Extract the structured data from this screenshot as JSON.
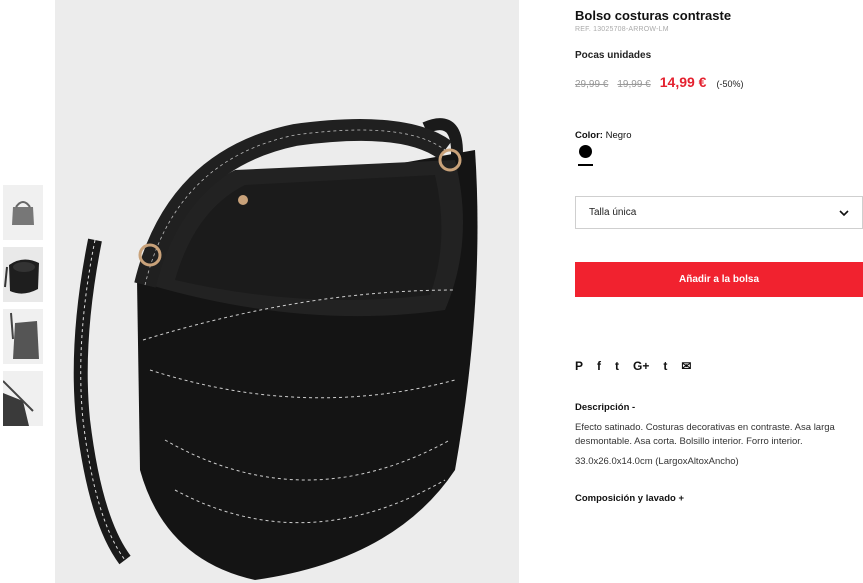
{
  "product": {
    "title": "Bolso costuras contraste",
    "ref": "REF. 13025708-ARROW-LM",
    "stock": "Pocas unidades",
    "prices": {
      "old1": "29,99 €",
      "old2": "19,99 €",
      "current": "14,99 €",
      "discount": "(-50%)"
    },
    "accent_color": "#f1222f"
  },
  "color": {
    "label": "Color:",
    "value": "Negro",
    "swatch": "#000000"
  },
  "size": {
    "selected": "Talla única",
    "icon": "chevron-down-icon"
  },
  "add_button": "Añadir a la bolsa",
  "share": [
    "P",
    "f",
    "t",
    "G+",
    "t",
    "✉"
  ],
  "description": {
    "title": "Descripción -",
    "text": "Efecto satinado. Costuras decorativas en contraste. Asa larga desmontable. Asa corta. Bolsillo interior. Forro interior.",
    "dimensions": "33.0x26.0x14.0cm (LargoxAltoxAncho)"
  },
  "composition": {
    "title": "Composición y lavado +"
  },
  "thumbnails": [
    "thumb-1",
    "thumb-2",
    "thumb-3",
    "thumb-4"
  ]
}
